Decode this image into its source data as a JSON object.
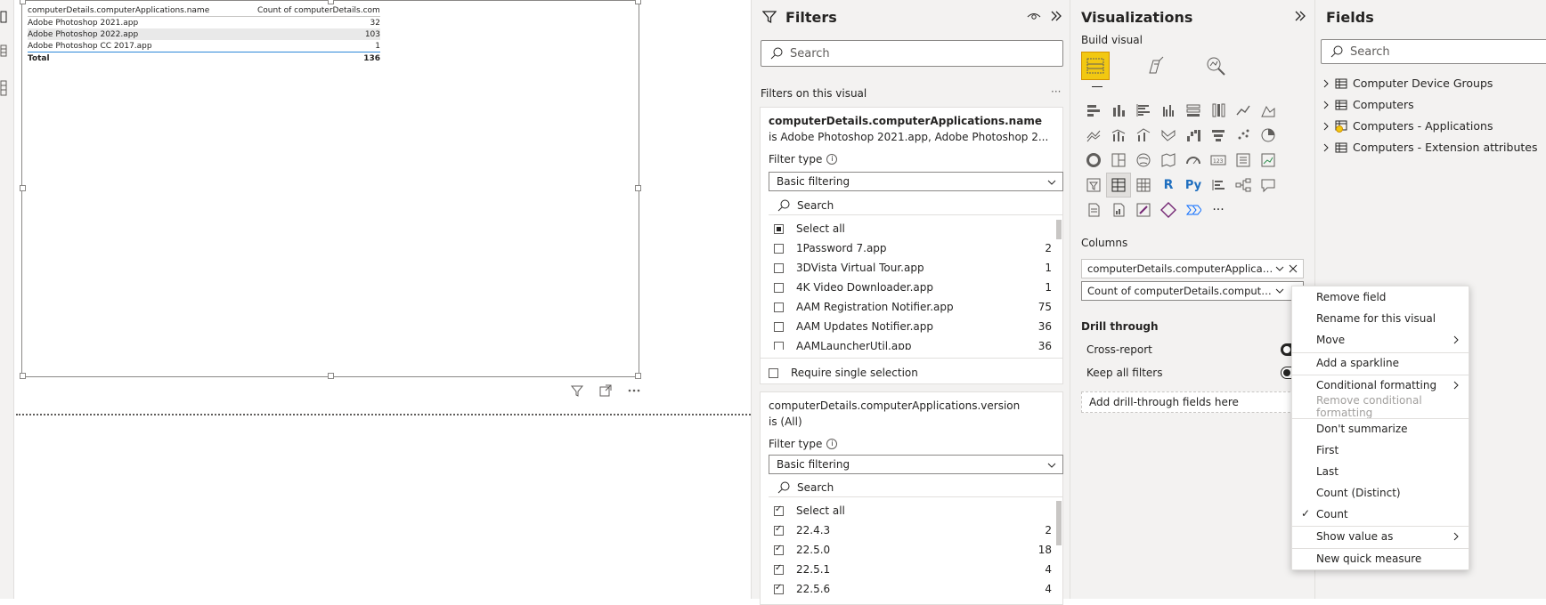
{
  "table": {
    "headers": [
      "computerDetails.computerApplications.name",
      "Count of computerDetails.computerApplications.version"
    ],
    "rows": [
      {
        "name": "Adobe Photoshop 2021.app",
        "count": "32"
      },
      {
        "name": "Adobe Photoshop 2022.app",
        "count": "103"
      },
      {
        "name": "Adobe Photoshop CC 2017.app",
        "count": "1"
      }
    ],
    "total_label": "Total",
    "total_value": "136"
  },
  "filters": {
    "title": "Filters",
    "search_placeholder": "Search",
    "section_label": "Filters on this visual",
    "more": "···",
    "card1": {
      "title": "computerDetails.computerApplications.name",
      "subtitle": "is Adobe Photoshop 2021.app, Adobe Photoshop 2...",
      "filter_type_label": "Filter type",
      "filter_type_value": "Basic filtering",
      "search_placeholder": "Search",
      "items": [
        {
          "label": "Select all",
          "count": ""
        },
        {
          "label": "1Password 7.app",
          "count": "2"
        },
        {
          "label": "3DVista Virtual Tour.app",
          "count": "1"
        },
        {
          "label": "4K Video Downloader.app",
          "count": "1"
        },
        {
          "label": "AAM Registration Notifier.app",
          "count": "75"
        },
        {
          "label": "AAM Updates Notifier.app",
          "count": "36"
        },
        {
          "label": "AAMLauncherUtil.app",
          "count": "36"
        }
      ],
      "require_single": "Require single selection"
    },
    "card2": {
      "title": "computerDetails.computerApplications.version",
      "subtitle": "is (All)",
      "filter_type_label": "Filter type",
      "filter_type_value": "Basic filtering",
      "search_placeholder": "Search",
      "items": [
        {
          "label": "Select all",
          "count": ""
        },
        {
          "label": "22.4.3",
          "count": "2"
        },
        {
          "label": "22.5.0",
          "count": "18"
        },
        {
          "label": "22.5.1",
          "count": "4"
        },
        {
          "label": "22.5.6",
          "count": "4"
        }
      ]
    }
  },
  "viz": {
    "title": "Visualizations",
    "build_visual": "Build visual",
    "columns_label": "Columns",
    "col1": "computerDetails.computerApplications...",
    "col2": "Count of computerDetails.computerAp...",
    "drill_through": "Drill through",
    "cross_report": "Cross-report",
    "keep_all_filters": "Keep all filters",
    "drop_label": "Add drill-through fields here",
    "more": "···",
    "icon_r": "R",
    "icon_py": "Py"
  },
  "fields": {
    "title": "Fields",
    "search_placeholder": "Search",
    "tables": [
      "Computer Device Groups",
      "Computers",
      "Computers - Applications",
      "Computers - Extension attributes"
    ]
  },
  "context_menu": {
    "items": [
      "Remove field",
      "Rename for this visual",
      "Move",
      "Add a sparkline",
      "Conditional formatting",
      "Remove conditional formatting",
      "Don't summarize",
      "First",
      "Last",
      "Count (Distinct)",
      "Count",
      "Show value as",
      "New quick measure"
    ]
  },
  "colors": {
    "accent": "#f2c811",
    "pane_bg": "#f3f2f1",
    "selected_text": "#252423"
  }
}
